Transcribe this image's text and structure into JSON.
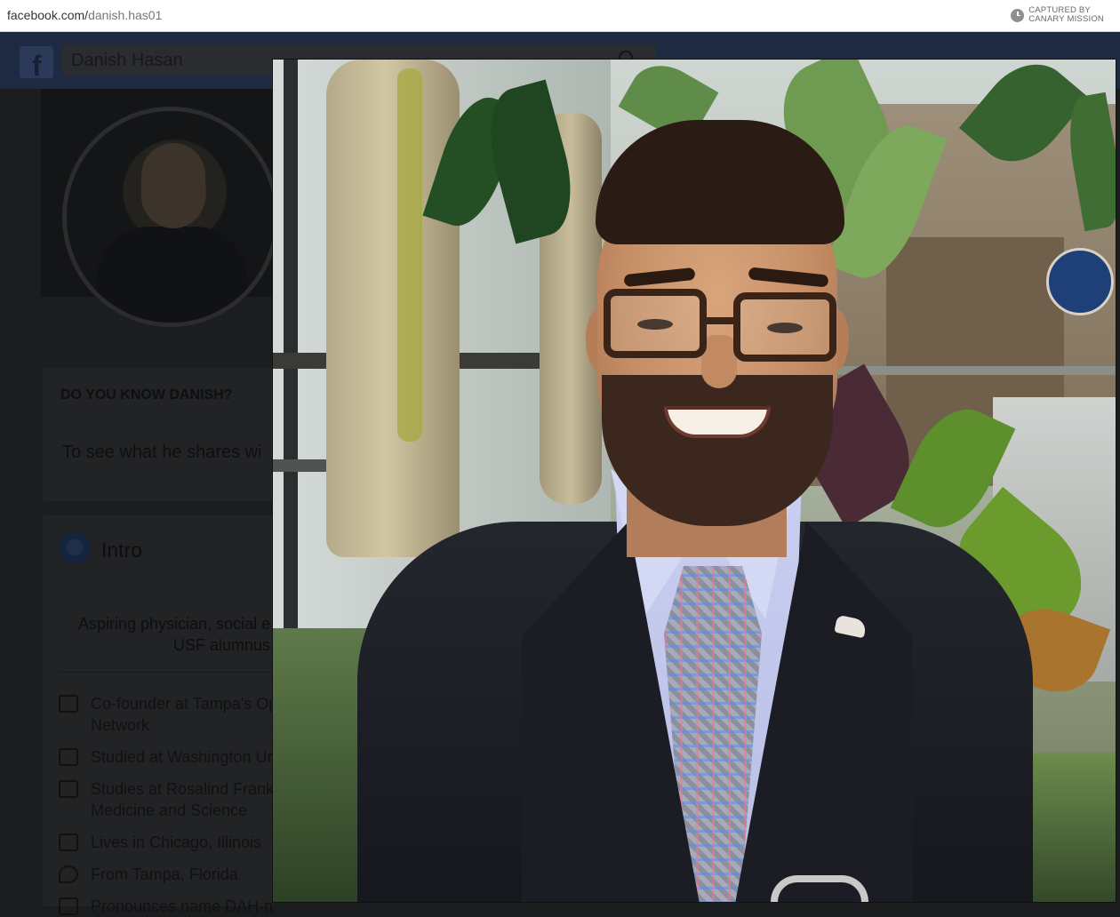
{
  "browser": {
    "url_domain": "facebook.com/",
    "url_path": "danish.has01",
    "captured_line1": "CAPTURED BY",
    "captured_line2": "CANARY MISSION"
  },
  "header": {
    "logo_icon": "facebook-logo-icon",
    "search_value": "Danish Hasan",
    "search_icon": "search-icon"
  },
  "know_card": {
    "title": "DO YOU KNOW DANISH?",
    "text": "To see what he shares wi"
  },
  "intro": {
    "icon": "globe-icon",
    "title": "Intro",
    "bio_line1": "Aspiring physician, social e",
    "bio_line2": "USF alumnus",
    "items": [
      {
        "icon": "briefcase-icon",
        "line1": "Co-founder at Tampa's Op",
        "line2": "Network"
      },
      {
        "icon": "graduation-cap-icon",
        "line1": "Studied at Washington Ur",
        "line2": ""
      },
      {
        "icon": "graduation-cap-icon",
        "line1": "Studies at Rosalind Frank",
        "line2": "Medicine and Science"
      },
      {
        "icon": "home-icon",
        "line1": "Lives in Chicago, Illinois",
        "line2": ""
      },
      {
        "icon": "location-pin-icon",
        "line1": "From Tampa, Florida",
        "line2": ""
      },
      {
        "icon": "speaker-icon",
        "line1": "Pronounces name DAH-n",
        "line2": ""
      }
    ]
  },
  "photo_viewer": {
    "subject": "profile-photo"
  },
  "colors": {
    "overlay_dim": "#1b1c1e",
    "fb_blue_dim": "#1d2a42"
  }
}
